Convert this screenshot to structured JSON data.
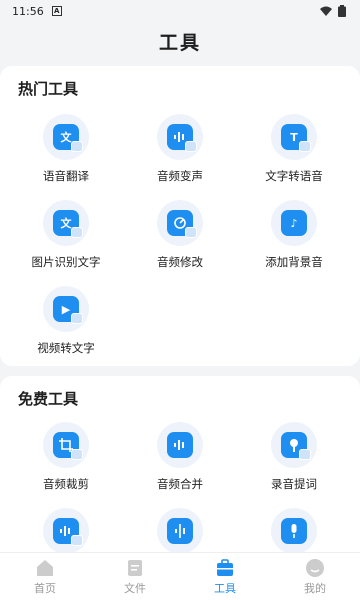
{
  "status": {
    "time": "11:56",
    "notif_icon": "A"
  },
  "header": {
    "title": "工具"
  },
  "hot": {
    "title": "热门工具",
    "items": [
      {
        "label": "语音翻译",
        "icon": "translate-icon",
        "glyph": "文"
      },
      {
        "label": "音频变声",
        "icon": "voice-change-icon",
        "glyph": ""
      },
      {
        "label": "文字转语音",
        "icon": "text-to-speech-icon",
        "glyph": "T"
      },
      {
        "label": "图片识别文字",
        "icon": "image-ocr-icon",
        "glyph": "文"
      },
      {
        "label": "音频修改",
        "icon": "audio-edit-icon",
        "glyph": ""
      },
      {
        "label": "添加背景音",
        "icon": "background-music-icon",
        "glyph": "♪"
      },
      {
        "label": "视频转文字",
        "icon": "video-to-text-icon",
        "glyph": "▶"
      }
    ]
  },
  "free": {
    "title": "免费工具",
    "items": [
      {
        "label": "音频裁剪",
        "icon": "audio-crop-icon",
        "glyph": ""
      },
      {
        "label": "音频合并",
        "icon": "audio-merge-icon",
        "glyph": ""
      },
      {
        "label": "录音提词",
        "icon": "recording-prompter-icon",
        "glyph": ""
      },
      {
        "label": "",
        "icon": "audio-wave-icon",
        "glyph": ""
      },
      {
        "label": "",
        "icon": "audio-split-icon",
        "glyph": ""
      },
      {
        "label": "",
        "icon": "microphone-icon",
        "glyph": ""
      }
    ]
  },
  "tabs": [
    {
      "label": "首页",
      "icon": "home-icon",
      "active": false
    },
    {
      "label": "文件",
      "icon": "file-icon",
      "active": false
    },
    {
      "label": "工具",
      "icon": "toolbox-icon",
      "active": true
    },
    {
      "label": "我的",
      "icon": "profile-icon",
      "active": false
    }
  ],
  "colors": {
    "accent": "#1f8ef1",
    "inactive": "#999999",
    "background": "#f3f4f6"
  }
}
